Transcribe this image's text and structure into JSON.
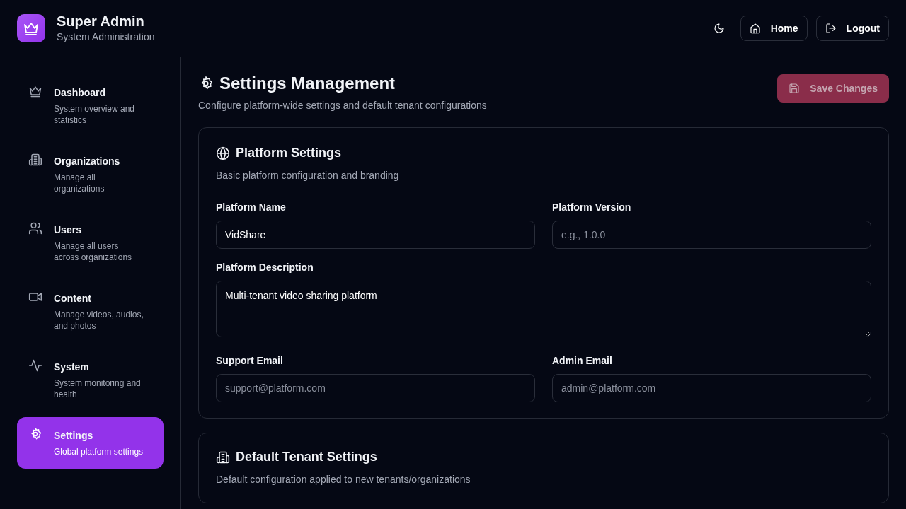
{
  "header": {
    "title": "Super Admin",
    "subtitle": "System Administration",
    "buttons": [
      {
        "kind": "theme"
      },
      {
        "kind": "home",
        "label": "Home"
      },
      {
        "kind": "logout",
        "label": "Logout"
      }
    ]
  },
  "sidebar": {
    "items": [
      {
        "label": "Dashboard",
        "description": "System overview and statistics",
        "selected": false
      },
      {
        "label": "Organizations",
        "description": "Manage all organizations",
        "selected": false
      },
      {
        "label": "Users",
        "description": "Manage all users across organizations",
        "selected": false
      },
      {
        "label": "Content",
        "description": "Manage videos, audios, and photos",
        "selected": false
      },
      {
        "label": "System",
        "description": "System monitoring and health",
        "selected": false
      },
      {
        "label": "Settings",
        "description": "Global platform settings",
        "selected": true
      }
    ]
  },
  "page": {
    "title": "Settings Management",
    "subtitle": "Configure platform-wide settings and default tenant configurations",
    "save_button": {
      "label": "Save Changes",
      "disabled": true
    }
  },
  "sections": [
    {
      "title": "Platform Settings",
      "description": "Basic platform configuration and branding",
      "fields": [
        {
          "kind": "input",
          "label": "Platform Name",
          "value": "VidShare"
        },
        {
          "kind": "input",
          "label": "Platform Version",
          "placeholder": "e.g., 1.0.0"
        },
        {
          "kind": "textarea",
          "label": "Platform Description",
          "value": "Multi-tenant video sharing platform"
        },
        {
          "kind": "input",
          "label": "Support Email",
          "placeholder": "support@platform.com"
        },
        {
          "kind": "input",
          "label": "Admin Email",
          "placeholder": "admin@platform.com"
        }
      ]
    },
    {
      "title": "Default Tenant Settings",
      "description": "Default configuration applied to new tenants/organizations"
    }
  ]
}
